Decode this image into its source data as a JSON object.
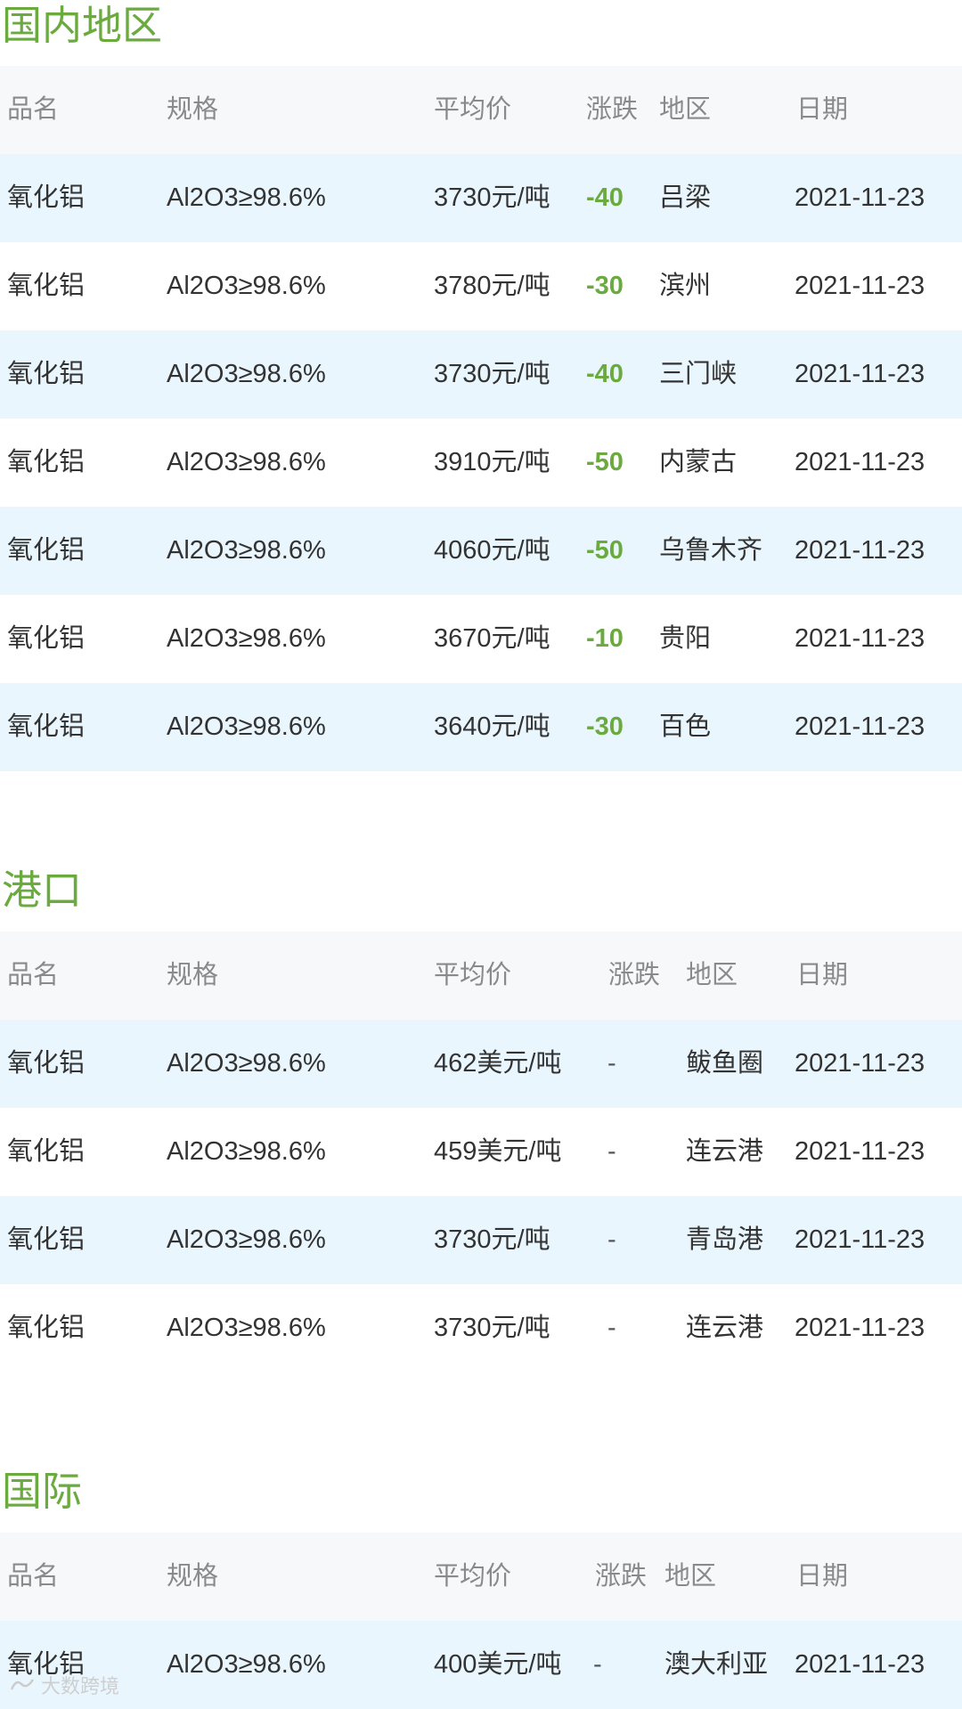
{
  "sections": [
    {
      "title": "国内地区",
      "headers": {
        "name": "品名",
        "spec": "规格",
        "price": "平均价",
        "change": "涨跌",
        "region": "地区",
        "date": "日期"
      },
      "rows": [
        {
          "name": "氧化铝",
          "spec": "Al2O3≥98.6%",
          "price": "3730元/吨",
          "change": "-40",
          "region": "吕梁",
          "date": "2021-11-23"
        },
        {
          "name": "氧化铝",
          "spec": "Al2O3≥98.6%",
          "price": "3780元/吨",
          "change": "-30",
          "region": "滨州",
          "date": "2021-11-23"
        },
        {
          "name": "氧化铝",
          "spec": "Al2O3≥98.6%",
          "price": "3730元/吨",
          "change": "-40",
          "region": "三门峡",
          "date": "2021-11-23"
        },
        {
          "name": "氧化铝",
          "spec": "Al2O3≥98.6%",
          "price": "3910元/吨",
          "change": "-50",
          "region": "内蒙古",
          "date": "2021-11-23"
        },
        {
          "name": "氧化铝",
          "spec": "Al2O3≥98.6%",
          "price": "4060元/吨",
          "change": "-50",
          "region": "乌鲁木齐",
          "date": "2021-11-23"
        },
        {
          "name": "氧化铝",
          "spec": "Al2O3≥98.6%",
          "price": "3670元/吨",
          "change": "-10",
          "region": "贵阳",
          "date": "2021-11-23"
        },
        {
          "name": "氧化铝",
          "spec": "Al2O3≥98.6%",
          "price": "3640元/吨",
          "change": "-30",
          "region": "百色",
          "date": "2021-11-23"
        }
      ]
    },
    {
      "title": "港口",
      "headers": {
        "name": "品名",
        "spec": "规格",
        "price": "平均价",
        "change": "涨跌",
        "region": "地区",
        "date": "日期"
      },
      "rows": [
        {
          "name": "氧化铝",
          "spec": "Al2O3≥98.6%",
          "price": "462美元/吨",
          "change": "-",
          "region": "鲅鱼圈",
          "date": "2021-11-23"
        },
        {
          "name": "氧化铝",
          "spec": "Al2O3≥98.6%",
          "price": "459美元/吨",
          "change": "-",
          "region": "连云港",
          "date": "2021-11-23"
        },
        {
          "name": "氧化铝",
          "spec": "Al2O3≥98.6%",
          "price": "3730元/吨",
          "change": "-",
          "region": "青岛港",
          "date": "2021-11-23"
        },
        {
          "name": "氧化铝",
          "spec": "Al2O3≥98.6%",
          "price": "3730元/吨",
          "change": "-",
          "region": "连云港",
          "date": "2021-11-23"
        }
      ]
    },
    {
      "title": "国际",
      "headers": {
        "name": "品名",
        "spec": "规格",
        "price": "平均价",
        "change": "涨跌",
        "region": "地区",
        "date": "日期"
      },
      "rows": [
        {
          "name": "氧化铝",
          "spec": "Al2O3≥98.6%",
          "price": "400美元/吨",
          "change": "-",
          "region": "澳大利亚",
          "date": "2021-11-23"
        }
      ]
    }
  ],
  "colors": {
    "title_green": "#6aaa3e",
    "change_green": "#6aaa3e",
    "row_shaded": "#eaf6fd",
    "header_bg": "#f7f8fa"
  },
  "watermark": {
    "icon": "brand-logo-icon",
    "text": "大数跨境"
  }
}
